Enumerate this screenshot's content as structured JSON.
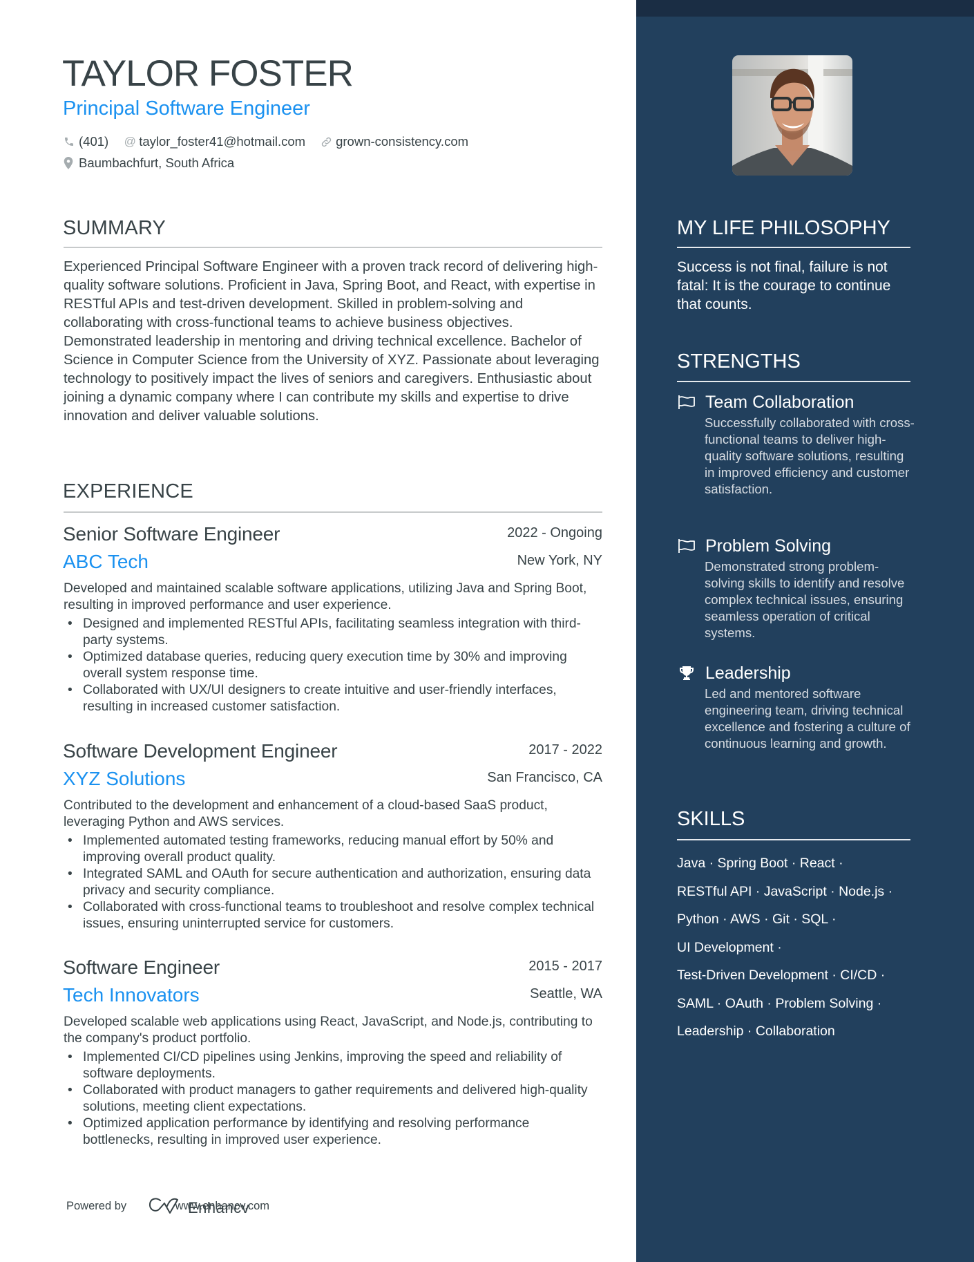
{
  "header": {
    "name": "TAYLOR FOSTER",
    "title": "Principal Software Engineer",
    "contacts": {
      "phone": {
        "icon": "phone-icon",
        "value": "(401)"
      },
      "email": {
        "icon": "at-icon",
        "value": "taylor_foster41@hotmail.com"
      },
      "website": {
        "icon": "link-icon",
        "value": "grown-consistency.com"
      },
      "location": {
        "icon": "location-pin-icon",
        "value": "Baumbachfurt, South Africa"
      }
    }
  },
  "summary": {
    "heading": "SUMMARY",
    "text": "Experienced Principal Software Engineer with a proven track record of delivering high-quality software solutions. Proficient in Java, Spring Boot, and React, with expertise in RESTful APIs and test-driven development. Skilled in problem-solving and collaborating with cross-functional teams to achieve business objectives. Demonstrated leadership in mentoring and driving technical excellence. Bachelor of Science in Computer Science from the University of XYZ. Passionate about leveraging technology to positively impact the lives of seniors and caregivers. Enthusiastic about joining a dynamic company where I can contribute my skills and expertise to drive innovation and deliver valuable solutions."
  },
  "experience": {
    "heading": "EXPERIENCE",
    "jobs": [
      {
        "position": "Senior Software Engineer",
        "dates": "2022 - Ongoing",
        "company": "ABC Tech",
        "location": "New York, NY",
        "description": "Developed and maintained scalable software applications, utilizing Java and Spring Boot, resulting in improved performance and user experience.",
        "bullets": [
          "Designed and implemented RESTful APIs, facilitating seamless integration with third-party systems.",
          "Optimized database queries, reducing query execution time by 30% and improving overall system response time.",
          "Collaborated with UX/UI designers to create intuitive and user-friendly interfaces, resulting in increased customer satisfaction."
        ]
      },
      {
        "position": "Software Development Engineer",
        "dates": "2017 - 2022",
        "company": "XYZ Solutions",
        "location": "San Francisco, CA",
        "description": "Contributed to the development and enhancement of a cloud-based SaaS product, leveraging Python and AWS services.",
        "bullets": [
          "Implemented automated testing frameworks, reducing manual effort by 50% and improving overall product quality.",
          "Integrated SAML and OAuth for secure authentication and authorization, ensuring data privacy and security compliance.",
          "Collaborated with cross-functional teams to troubleshoot and resolve complex technical issues, ensuring uninterrupted service for customers."
        ]
      },
      {
        "position": "Software Engineer",
        "dates": "2015 - 2017",
        "company": "Tech Innovators",
        "location": "Seattle, WA",
        "description": "Developed scalable web applications using React, JavaScript, and Node.js, contributing to the company's product portfolio.",
        "bullets": [
          "Implemented CI/CD pipelines using Jenkins, improving the speed and reliability of software deployments.",
          "Collaborated with product managers to gather requirements and delivered high-quality solutions, meeting client expectations.",
          "Optimized application performance by identifying and resolving performance bottlenecks, resulting in improved user experience."
        ]
      }
    ]
  },
  "sidebar": {
    "photo": {
      "alt": "Profile photo of Taylor Foster",
      "icon": "profile-photo"
    },
    "philosophy": {
      "heading": "MY LIFE PHILOSOPHY",
      "text": "Success is not final, failure is not fatal: It is the courage to continue that counts."
    },
    "strengths": {
      "heading": "STRENGTHS",
      "items": [
        {
          "icon": "flag-icon",
          "title": "Team Collaboration",
          "description": "Successfully collaborated with cross-functional teams to deliver high-quality software solutions, resulting in improved efficiency and customer satisfaction."
        },
        {
          "icon": "flag-icon",
          "title": "Problem Solving",
          "description": "Demonstrated strong problem-solving skills to identify and resolve complex technical issues, ensuring seamless operation of critical systems."
        },
        {
          "icon": "trophy-icon",
          "title": "Leadership",
          "description": "Led and mentored software engineering team, driving technical excellence and fostering a culture of continuous learning and growth."
        }
      ]
    },
    "skills": {
      "heading": "SKILLS",
      "lines": [
        "Java · Spring Boot · React ·",
        "RESTful API · JavaScript · Node.js ·",
        "Python · AWS · Git · SQL ·",
        "UI Development ·",
        "Test-Driven Development · CI/CD ·",
        "SAML · OAuth · Problem Solving ·",
        "Leadership · Collaboration"
      ]
    }
  },
  "footer": {
    "powered_by": "Powered by",
    "brand": "Enhancv",
    "url": "www.enhancv.com"
  },
  "colors": {
    "accent": "#1a91f0",
    "sidebar_bg": "#22405d",
    "sidebar_band": "#1a2d44",
    "text": "#384347"
  }
}
